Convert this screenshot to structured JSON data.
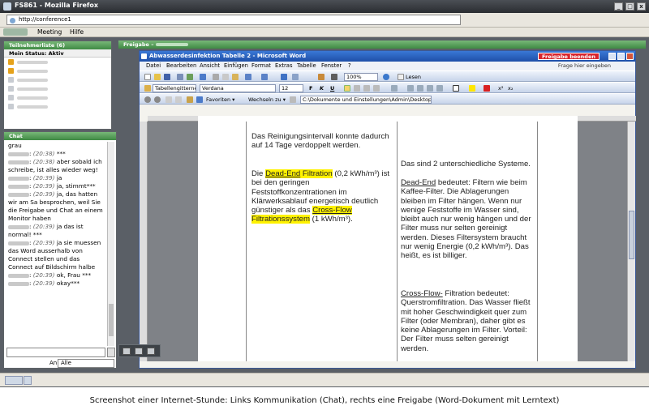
{
  "browser": {
    "title": "FS861 - Mozilla Firefox",
    "url": "http://conference1"
  },
  "connect_menu": {
    "items": [
      "Meeting",
      "Hilfe"
    ]
  },
  "attendees": {
    "header": "Teilnehmerliste (6)",
    "status": "Mein Status: Aktiv"
  },
  "chat": {
    "header": "Chat",
    "lines": [
      {
        "text": "grau"
      },
      {
        "time": "(20:38)",
        "text": "***"
      },
      {
        "time": "(20:38)",
        "text": "aber sobald ich schreibe, ist alles wieder weg!"
      },
      {
        "time": "(20:39)",
        "text": "ja"
      },
      {
        "time": "(20:39)",
        "text": "ja, stimmt***"
      },
      {
        "time": "(20:39)",
        "text": "ja, das hatten wir am Sa besprochen, weil Sie die Freigabe und Chat an einem Monitor haben"
      },
      {
        "time": "(20:39)",
        "text": "ja das ist normal! ***"
      },
      {
        "time": "(20:39)",
        "text": "ja sie muessen das Word ausserhalb von Connect stellen und das Connect auf Bildschirm halbe"
      },
      {
        "time": "(20:39)",
        "text": "ok, Frau ***"
      },
      {
        "time": "(20:39)",
        "text": "okay***"
      }
    ],
    "to_label": "An:",
    "to_value": "Alle"
  },
  "share": {
    "header": "Freigabe",
    "stop_label": "Freigabe beenden"
  },
  "word": {
    "title": "Abwasserdesinfektion Tabelle 2 - Microsoft Word",
    "menu": [
      "Datei",
      "Bearbeiten",
      "Ansicht",
      "Einfügen",
      "Format",
      "Extras",
      "Tabelle",
      "Fenster",
      "?"
    ],
    "help_placeholder": "Frage hier eingeben",
    "zoom": "100%",
    "read_label": "Lesen",
    "style": "Tabellengitternetz",
    "font": "Verdana",
    "size": "12",
    "favorites": "Favoriten",
    "goto": "Wechseln zu",
    "path": "C:\\Dokumente und Einstellungen\\Admin\\Desktop\\Ab"
  },
  "doc": {
    "left_p1": "Das Reinigungsintervall konnte dadurch auf 14 Tage verdoppelt werden.",
    "left_p2_pre": "Die ",
    "left_p2_hl1a": "Dead-End",
    "left_p2_hl1b": " Filtration",
    "left_p2_mid": " (0,2 kWh/m³) ist bei den geringen Feststoffkonzentrationen im Klärwerksablauf energetisch deutlich günstiger als das ",
    "left_p2_hl2a": "Cross-Flow",
    "left_p2_hl2b": " Filtrationssystem",
    "left_p2_end": " (1 kWh/m³).",
    "right_p1": "Das sind 2 unterschiedliche Systeme.",
    "right_p2_term": "Dead-End",
    "right_p2": " bedeutet: Filtern wie beim Kaffee-Filter. Die Ablagerungen bleiben im Filter hängen.  Wenn nur wenige Feststoffe im Wasser sind, bleibt auch nur wenig hängen und der Filter muss nur selten gereinigt werden. Dieses Filtersystem braucht nur wenig Energie (0,2 kWh/m³). Das heißt, es ist billiger.",
    "right_p3_term": "Cross-Flow-",
    "right_p3": " Filtration bedeutet: Querstromfiltration. Das Wasser fließt mit hoher Geschwindigkeit quer zum Filter (oder Membran), daher gibt es keine Ablagerungen im Filter. Vorteil: Der Filter muss selten gereinigt werden."
  },
  "caption": "Screenshot einer Internet-Stunde: Links Kommunikation (Chat), rechts eine Freigabe (Word-Dokument mit Lerntext)"
}
